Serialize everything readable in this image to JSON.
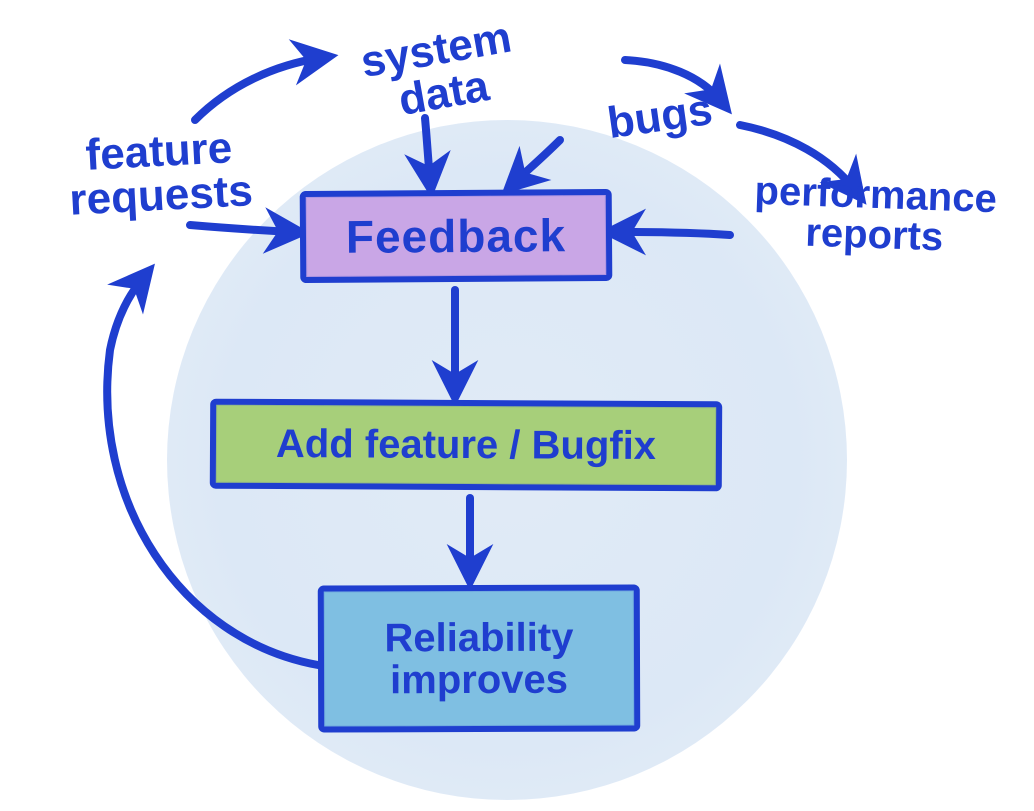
{
  "boxes": {
    "feedback": "Feedback",
    "add_feature": "Add feature / Bugfix",
    "reliability": "Reliability\nimproves"
  },
  "inputs": {
    "feature_requests": "feature\nrequests",
    "system_data": "system\ndata",
    "bugs": "bugs",
    "performance_reports": "performance\nreports"
  },
  "colors": {
    "stroke": "#1f3ecf",
    "bg_circle": "#dbe7f5",
    "feedback_fill": "#c9a6e6",
    "addfeature_fill": "#a7cf7a",
    "reliability_fill": "#7fbfe2"
  },
  "diagram": {
    "type": "cycle-flow",
    "nodes": [
      {
        "id": "feedback",
        "label": "Feedback"
      },
      {
        "id": "add_feature",
        "label": "Add feature / Bugfix"
      },
      {
        "id": "reliability",
        "label": "Reliability improves"
      }
    ],
    "edges": [
      {
        "from": "feedback",
        "to": "add_feature"
      },
      {
        "from": "add_feature",
        "to": "reliability"
      },
      {
        "from": "reliability",
        "to": "feedback",
        "note": "loop-back"
      }
    ],
    "external_inputs_to_feedback": [
      "feature requests",
      "system data",
      "bugs",
      "performance reports"
    ]
  }
}
